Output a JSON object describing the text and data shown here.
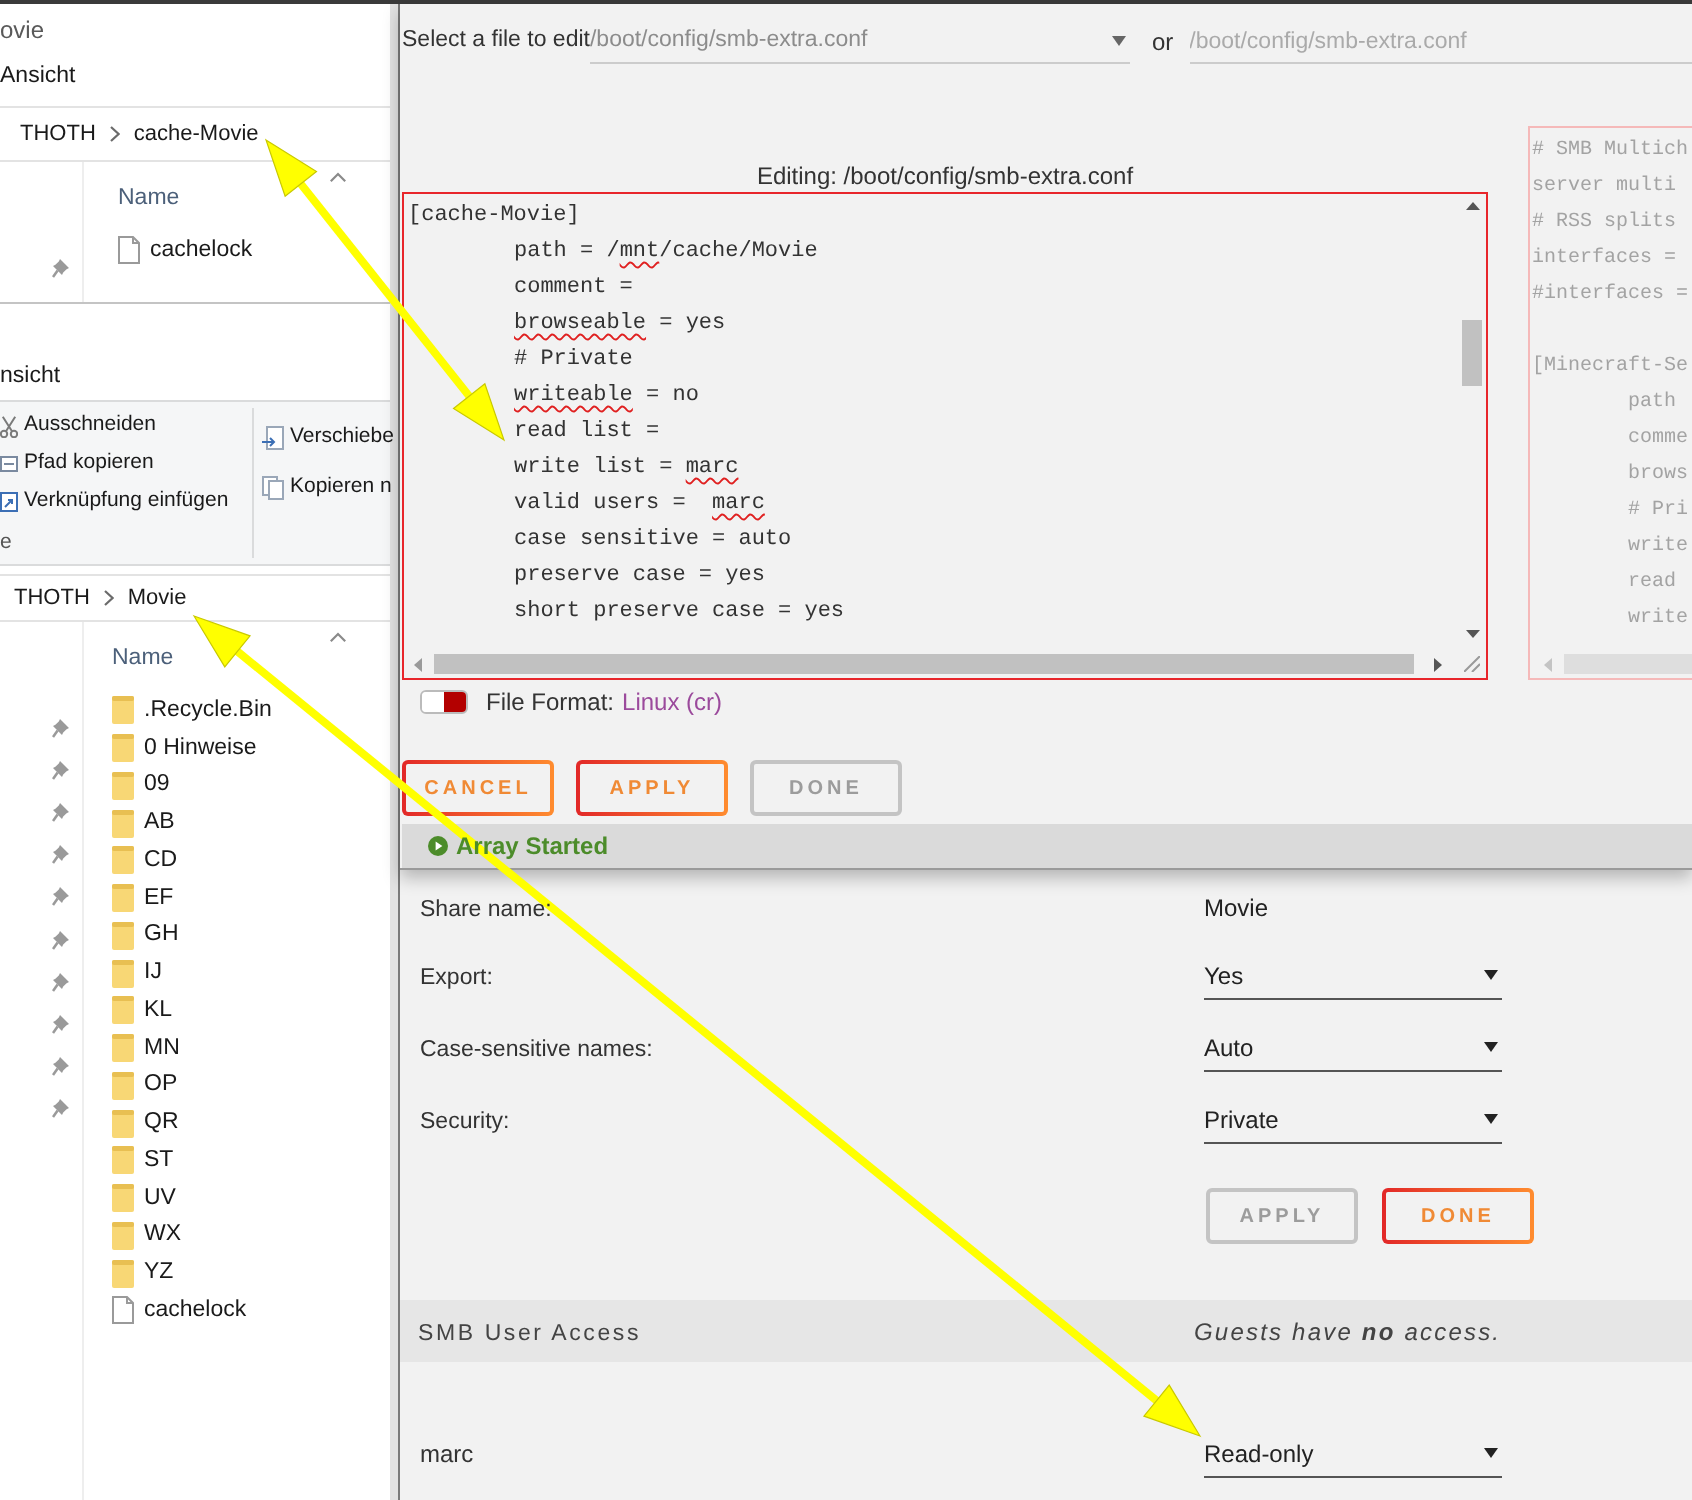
{
  "explorer_windows": [
    {
      "title": "ovie",
      "ribbon_tab": "Ansicht",
      "breadcrumb": [
        "THOTH",
        "cache-Movie"
      ],
      "column_header": "Name",
      "nav_items": [
        {
          "pinned": true
        }
      ],
      "items": [
        {
          "kind": "file",
          "name": "cachelock"
        }
      ]
    },
    {
      "ribbon_tab": "nsicht",
      "ribbon_groups": [
        {
          "items": [
            "Ausschneiden",
            "Pfad kopieren",
            "Verknüpfung einfügen"
          ],
          "label": "e"
        },
        {
          "items": [
            "Verschiebe",
            "Kopieren n"
          ]
        }
      ],
      "breadcrumb": [
        "THOTH",
        "Movie"
      ],
      "column_header": "Name",
      "nav_items": [
        {
          "pinned": true
        },
        {
          "pinned": true
        },
        {
          "pinned": true
        },
        {
          "pinned": true
        },
        {
          "pinned": true
        },
        {
          "pinned": true
        },
        {
          "pinned": true
        },
        {
          "pinned": true
        },
        {
          "pinned": true
        },
        {
          "pinned": true
        }
      ],
      "items": [
        {
          "kind": "folder",
          "name": ".Recycle.Bin"
        },
        {
          "kind": "folder",
          "name": "0 Hinweise"
        },
        {
          "kind": "folder",
          "name": "09"
        },
        {
          "kind": "folder",
          "name": "AB"
        },
        {
          "kind": "folder",
          "name": "CD"
        },
        {
          "kind": "folder",
          "name": "EF"
        },
        {
          "kind": "folder",
          "name": "GH"
        },
        {
          "kind": "folder",
          "name": "IJ"
        },
        {
          "kind": "folder",
          "name": "KL"
        },
        {
          "kind": "folder",
          "name": "MN"
        },
        {
          "kind": "folder",
          "name": "OP"
        },
        {
          "kind": "folder",
          "name": "QR"
        },
        {
          "kind": "folder",
          "name": "ST"
        },
        {
          "kind": "folder",
          "name": "UV"
        },
        {
          "kind": "folder",
          "name": "WX"
        },
        {
          "kind": "folder",
          "name": "YZ"
        },
        {
          "kind": "file",
          "name": "cachelock"
        }
      ]
    }
  ],
  "editor": {
    "file_select": {
      "label": "Select a file to edit",
      "value": "/boot/config/smb-extra.conf"
    },
    "or_label": "or",
    "path_input": {
      "placeholder": "/boot/config/smb-extra.conf"
    },
    "title": "Editing: /boot/config/smb-extra.conf",
    "lines": [
      {
        "segments": [
          {
            "text": "[cache-Movie]",
            "misspelled": false
          }
        ],
        "children": [
          {
            "segments": [
              {
                "text": "path = /",
                "misspelled": false
              },
              {
                "text": "mnt",
                "misspelled": true
              },
              {
                "text": "/cache/Movie",
                "misspelled": false
              }
            ]
          },
          {
            "segments": [
              {
                "text": "comment =",
                "misspelled": false
              }
            ]
          },
          {
            "segments": [
              {
                "text": "browseable",
                "misspelled": true
              },
              {
                "text": " = yes",
                "misspelled": false
              }
            ]
          },
          {
            "segments": [
              {
                "text": "# Private",
                "misspelled": false
              }
            ]
          },
          {
            "segments": [
              {
                "text": "writeable",
                "misspelled": true
              },
              {
                "text": " = no",
                "misspelled": false
              }
            ]
          },
          {
            "segments": [
              {
                "text": "read list =",
                "misspelled": false
              }
            ]
          },
          {
            "segments": [
              {
                "text": "write list = ",
                "misspelled": false
              },
              {
                "text": "marc",
                "misspelled": true
              }
            ]
          },
          {
            "segments": [
              {
                "text": "valid users =  ",
                "misspelled": false
              },
              {
                "text": "marc",
                "misspelled": true
              }
            ]
          },
          {
            "segments": [
              {
                "text": "case sensitive = auto",
                "misspelled": false
              }
            ]
          },
          {
            "segments": [
              {
                "text": "preserve case = yes",
                "misspelled": false
              }
            ]
          },
          {
            "segments": [
              {
                "text": "short preserve case = yes",
                "misspelled": false
              }
            ]
          }
        ]
      }
    ],
    "preview_sections": [
      {
        "lines": [
          {
            "text": "# SMB Multich"
          },
          {
            "text": "server multi"
          },
          {
            "text": "# RSS splits"
          },
          {
            "text": "interfaces ="
          },
          {
            "text": "#interfaces ="
          }
        ]
      },
      {
        "lines": [
          {
            "text": "[Minecraft-Se",
            "children": [
              {
                "text": "path"
              },
              {
                "text": "comme"
              },
              {
                "text": "brows"
              },
              {
                "text": "# Pri"
              },
              {
                "text": "write"
              },
              {
                "text": "read"
              },
              {
                "text": "write"
              }
            ]
          }
        ]
      }
    ],
    "file_format": {
      "on": true,
      "label": "File Format:",
      "value": "Linux (cr)"
    },
    "buttons": [
      {
        "label": "CANCEL",
        "disabled": false
      },
      {
        "label": "APPLY",
        "disabled": false
      },
      {
        "label": "DONE",
        "disabled": true
      }
    ],
    "status": "Array Started"
  },
  "share_settings": {
    "fields": [
      {
        "kind": "text",
        "label": "Share name:",
        "value": "Movie"
      },
      {
        "kind": "select",
        "label": "Export:",
        "value": "Yes"
      },
      {
        "kind": "select",
        "label": "Case-sensitive names:",
        "value": "Auto"
      },
      {
        "kind": "select",
        "label": "Security:",
        "value": "Private"
      }
    ],
    "buttons": [
      {
        "label": "APPLY",
        "disabled": true
      },
      {
        "label": "DONE",
        "disabled": false
      }
    ]
  },
  "user_access": {
    "title": "SMB User Access",
    "note": "Guests have **no** access.",
    "users": [
      {
        "name": "marc",
        "access": "Read-only"
      }
    ]
  },
  "annotations": [
    {
      "kind": "double_arrow"
    },
    {
      "kind": "double_arrow"
    }
  ]
}
